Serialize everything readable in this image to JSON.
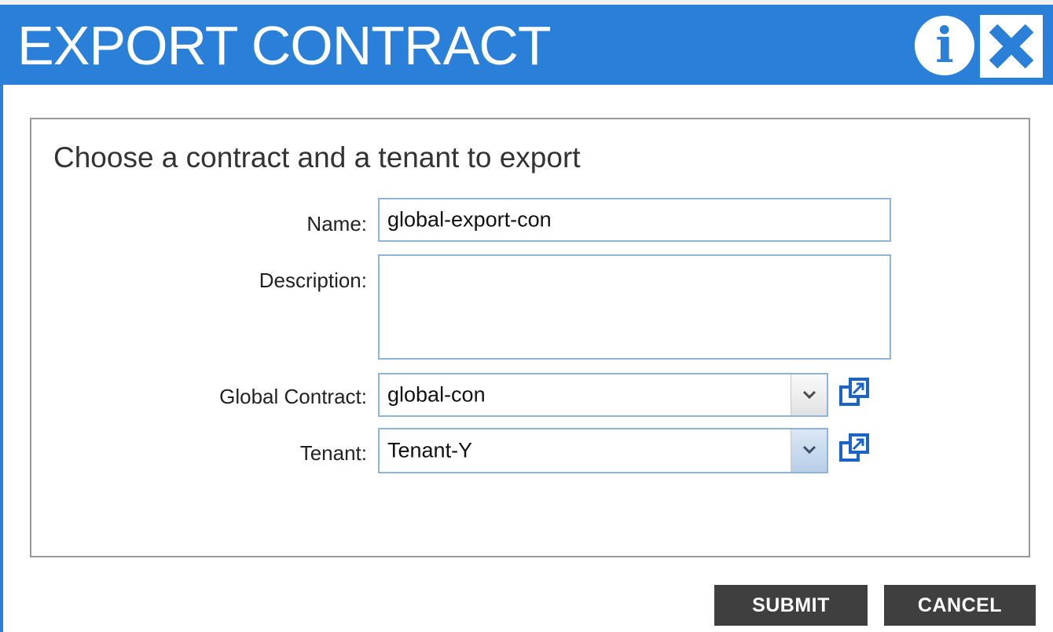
{
  "dialog": {
    "title": "EXPORT CONTRACT",
    "info_icon": "info-icon",
    "close_icon": "close-icon",
    "accent_color": "#2a7fd8"
  },
  "form": {
    "heading": "Choose a contract and a tenant to export",
    "name": {
      "label": "Name:",
      "value": "global-export-con"
    },
    "description": {
      "label": "Description:",
      "value": ""
    },
    "global_contract": {
      "label": "Global Contract:",
      "value": "global-con",
      "icon": "open-in-new-window-icon"
    },
    "tenant": {
      "label": "Tenant:",
      "value": "Tenant-Y",
      "icon": "open-in-new-window-icon"
    }
  },
  "buttons": {
    "submit": "SUBMIT",
    "cancel": "CANCEL",
    "color": "#3f3f3f"
  }
}
